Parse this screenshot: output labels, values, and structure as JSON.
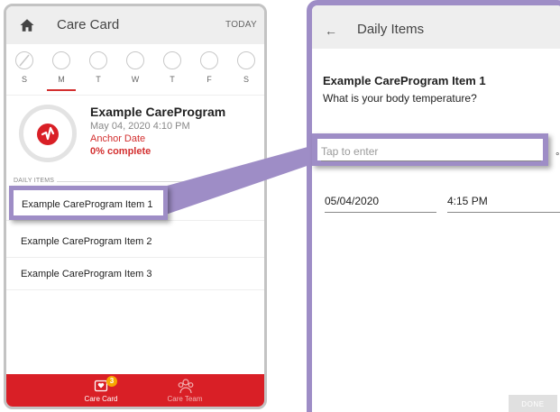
{
  "care_card": {
    "title": "Care Card",
    "today_label": "TODAY",
    "week": [
      {
        "label": "S",
        "selected": false,
        "skipped": true
      },
      {
        "label": "M",
        "selected": true,
        "skipped": false
      },
      {
        "label": "T",
        "selected": false,
        "skipped": false
      },
      {
        "label": "W",
        "selected": false,
        "skipped": false
      },
      {
        "label": "T",
        "selected": false,
        "skipped": false
      },
      {
        "label": "F",
        "selected": false,
        "skipped": false
      },
      {
        "label": "S",
        "selected": false,
        "skipped": false
      }
    ],
    "program": {
      "name": "Example CareProgram",
      "datetime": "May 04, 2020 4:10 PM",
      "anchor_label": "Anchor Date",
      "completion": "0% complete"
    },
    "section_header": "DAILY ITEMS",
    "items": [
      {
        "label": "Example CareProgram Item 1"
      },
      {
        "label": "Example CareProgram Item 2"
      },
      {
        "label": "Example CareProgram Item 3"
      }
    ],
    "bottom_nav": {
      "care_card_label": "Care Card",
      "care_card_badge": "3",
      "care_team_label": "Care Team"
    }
  },
  "daily_items": {
    "title": "Daily Items",
    "item_title": "Example CareProgram Item 1",
    "question": "What is your body temperature?",
    "input_placeholder": "Tap to enter",
    "unit": "°F",
    "date": "05/04/2020",
    "time": "4:15 PM",
    "done_label": "DONE"
  },
  "colors": {
    "accent_red": "#d91f26",
    "highlight_purple": "#9e8dc6",
    "badge_orange": "#f6a600"
  }
}
